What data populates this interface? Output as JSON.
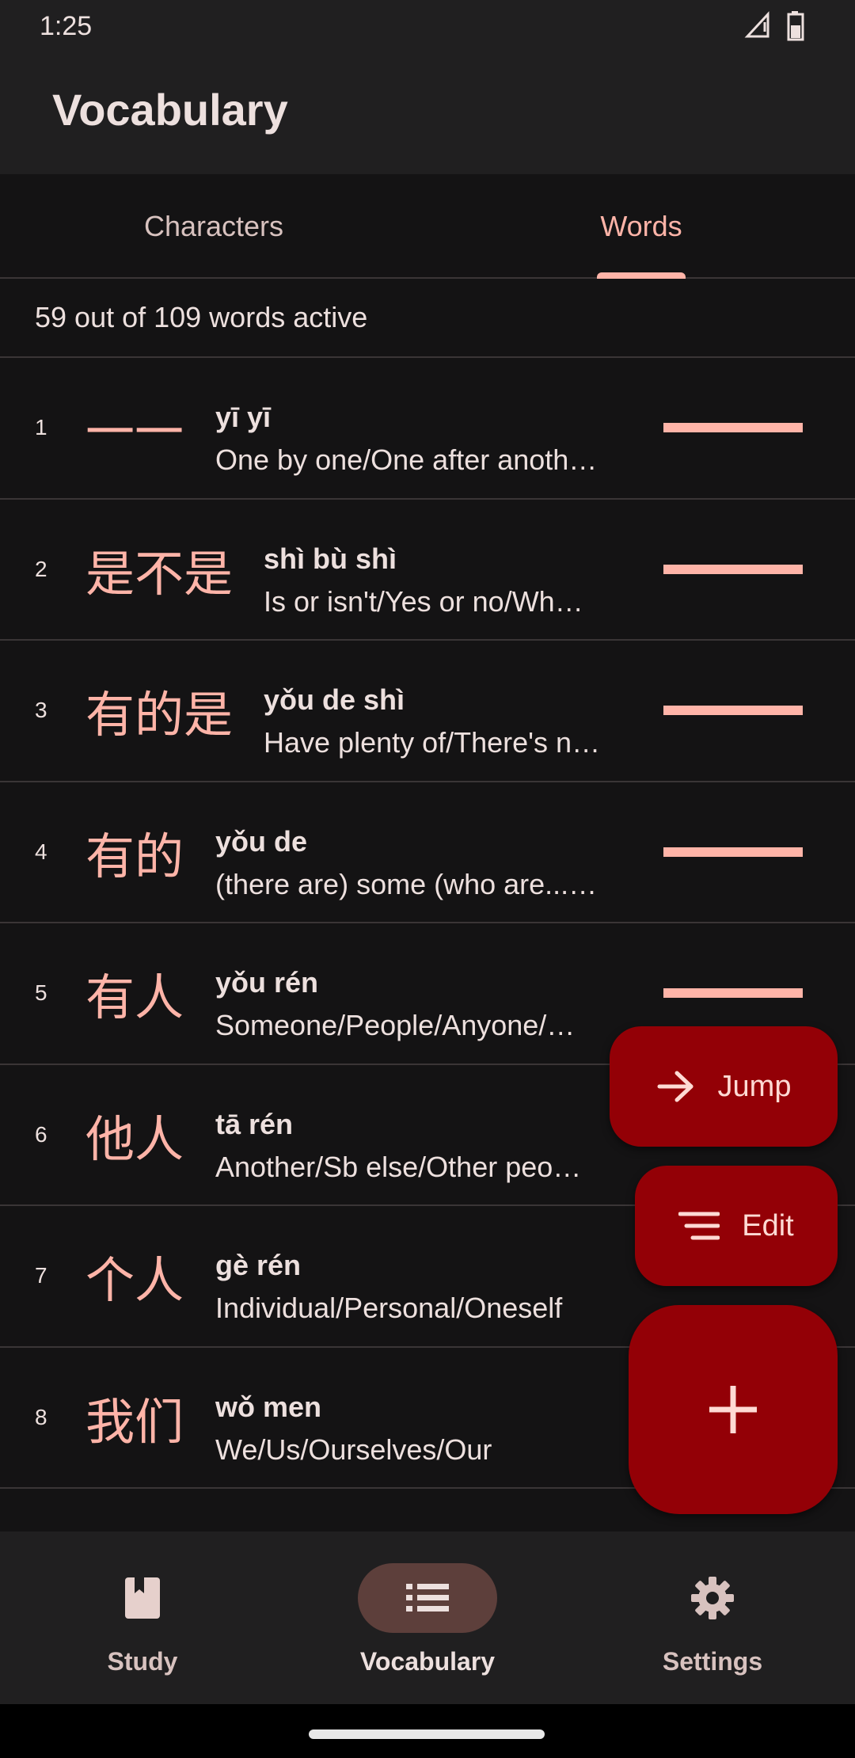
{
  "status_bar": {
    "time": "1:25"
  },
  "app_bar": {
    "title": "Vocabulary"
  },
  "tabs": [
    {
      "label": "Characters",
      "selected": false
    },
    {
      "label": "Words",
      "selected": true
    }
  ],
  "summary": "59 out of 109 words active",
  "words": [
    {
      "index": "1",
      "hanzi": "一一",
      "pinyin": "yī yī",
      "meaning": "One by one/One after anoth…"
    },
    {
      "index": "2",
      "hanzi": "是不是",
      "pinyin": "shì bù shì",
      "meaning": "Is or isn't/Yes or no/Wh…"
    },
    {
      "index": "3",
      "hanzi": "有的是",
      "pinyin": "yǒu de shì",
      "meaning": "Have plenty of/There's n…"
    },
    {
      "index": "4",
      "hanzi": "有的",
      "pinyin": "yǒu de",
      "meaning": "(there are) some (who are...…"
    },
    {
      "index": "5",
      "hanzi": "有人",
      "pinyin": "yǒu rén",
      "meaning": "Someone/People/Anyone/…"
    },
    {
      "index": "6",
      "hanzi": "他人",
      "pinyin": "tā rén",
      "meaning": "Another/Sb else/Other peo…"
    },
    {
      "index": "7",
      "hanzi": "个人",
      "pinyin": "gè rén",
      "meaning": "Individual/Personal/Oneself"
    },
    {
      "index": "8",
      "hanzi": "我们",
      "pinyin": "wǒ men",
      "meaning": "We/Us/Ourselves/Our"
    }
  ],
  "fabs": {
    "jump_label": "Jump",
    "edit_label": "Edit",
    "add_icon": "plus-icon"
  },
  "bottom_nav": [
    {
      "label": "Study",
      "icon": "book-icon",
      "active": false
    },
    {
      "label": "Vocabulary",
      "icon": "list-icon",
      "active": true
    },
    {
      "label": "Settings",
      "icon": "gear-icon",
      "active": false
    }
  ],
  "colors": {
    "accent": "#ffb4a8",
    "fab": "#930006",
    "background": "#141314",
    "surface": "#201f20"
  }
}
